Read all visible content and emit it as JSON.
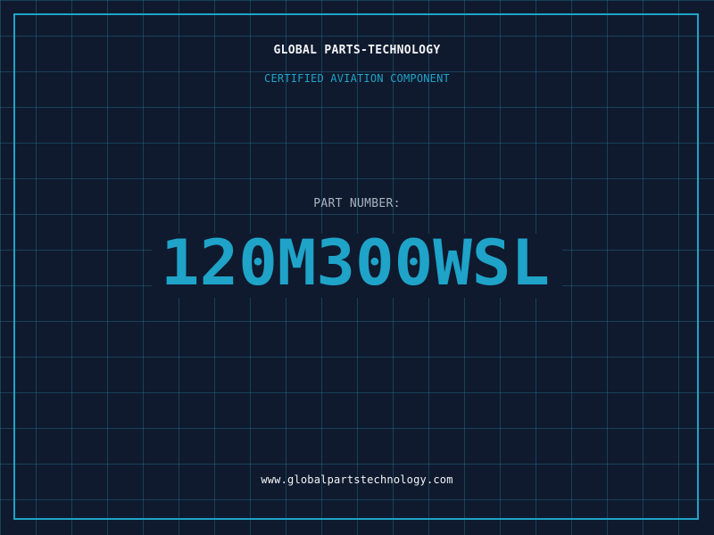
{
  "header": {
    "company": "GLOBAL PARTS-TECHNOLOGY",
    "tagline": "CERTIFIED AVIATION COMPONENT"
  },
  "part": {
    "label": "PART NUMBER:",
    "number": "120M300WSL"
  },
  "footer": {
    "url": "www.globalpartstechnology.com"
  },
  "colors": {
    "background": "#0f1a2e",
    "grid": "#286e8c",
    "accent": "#1fa3c8",
    "text": "#f2f4f7",
    "muted": "#a9b3c2"
  }
}
